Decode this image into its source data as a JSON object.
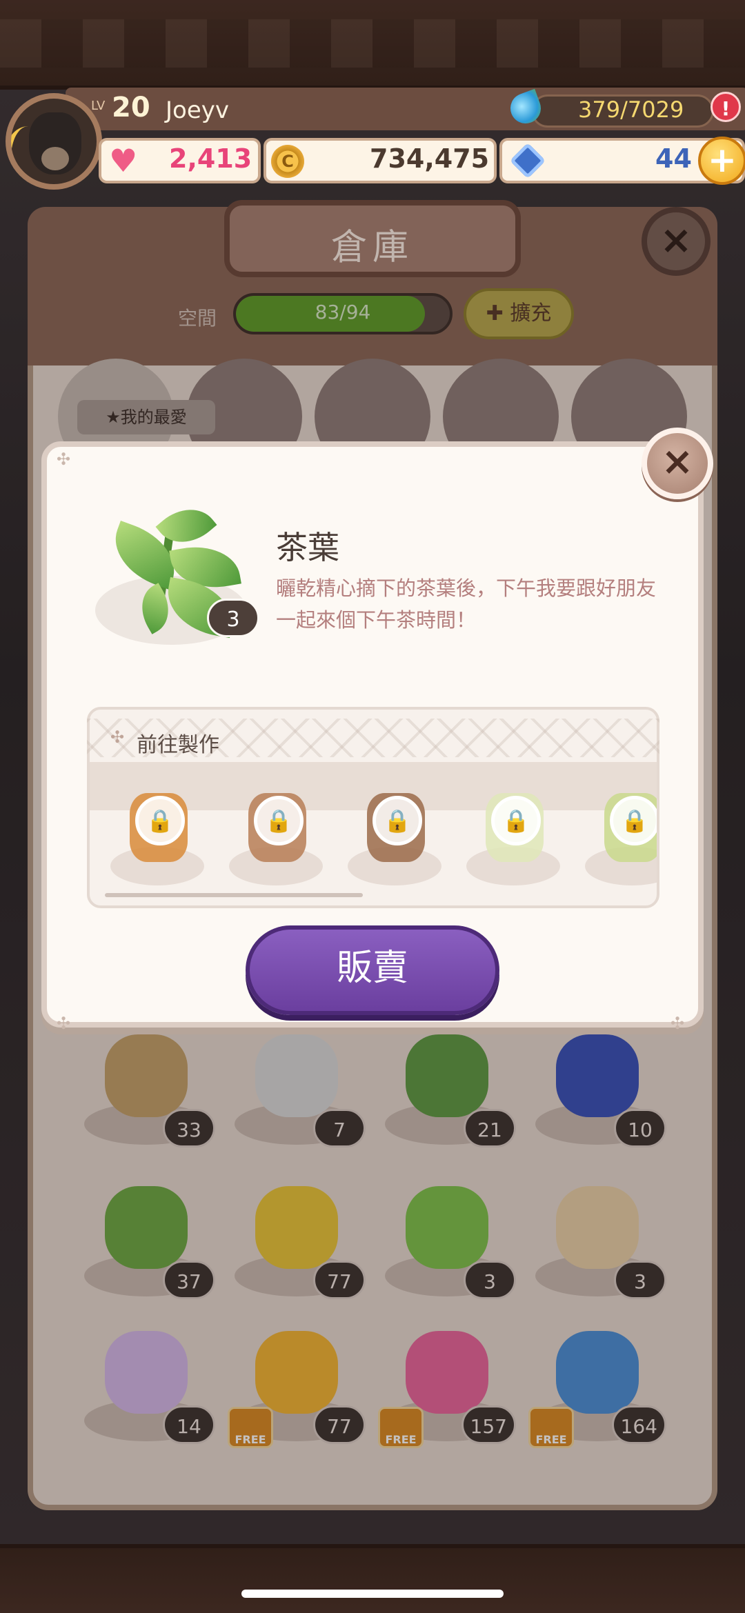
{
  "player": {
    "level_label": "LV",
    "level": "20",
    "name": "Joeyv"
  },
  "resources": {
    "energy": "379/7029",
    "alert": "!",
    "hearts": "2,413",
    "coins": "734,475",
    "coin_glyph": "C",
    "gems": "44",
    "add_label": "+"
  },
  "warehouse": {
    "title": "倉庫",
    "close": "×",
    "space_label": "空間",
    "space_value": "83/94",
    "space_fraction": 0.883,
    "expand_label": "✚ 擴充",
    "favorites_label": "★我的最愛"
  },
  "grid": [
    {
      "count": "33",
      "color": "#c3a06a"
    },
    {
      "count": "7",
      "color": "#d9d9d9"
    },
    {
      "count": "21",
      "color": "#5f9a45"
    },
    {
      "count": "10",
      "color": "#3a52b8"
    },
    {
      "count": "37",
      "color": "#6ea844"
    },
    {
      "count": "77",
      "color": "#e8c43a"
    },
    {
      "count": "3",
      "color": "#7fc24c"
    },
    {
      "count": "3",
      "color": "#e8cfa7"
    },
    {
      "count": "14",
      "color": "#d3b7e7"
    },
    {
      "count": "77",
      "color": "#f2b535",
      "free": "FREE"
    },
    {
      "count": "157",
      "color": "#e8669b",
      "free": "FREE"
    },
    {
      "count": "164",
      "color": "#4d8fd6",
      "free": "FREE"
    }
  ],
  "modal": {
    "close": "×",
    "item_name": "茶葉",
    "item_count": "3",
    "item_description": "曬乾精心摘下的茶葉後，下午我要跟好朋友一起來個下午茶時間！",
    "craft_title": "前往製作",
    "craft_items": [
      {
        "lock": "🔒",
        "color": "#d88b3a"
      },
      {
        "lock": "🔒",
        "color": "#b77e56"
      },
      {
        "lock": "🔒",
        "color": "#9b6b4a"
      },
      {
        "lock": "🔒",
        "color": "#dfe7b8"
      },
      {
        "lock": "🔒",
        "color": "#c9d98c"
      }
    ],
    "sell_label": "販賣"
  }
}
